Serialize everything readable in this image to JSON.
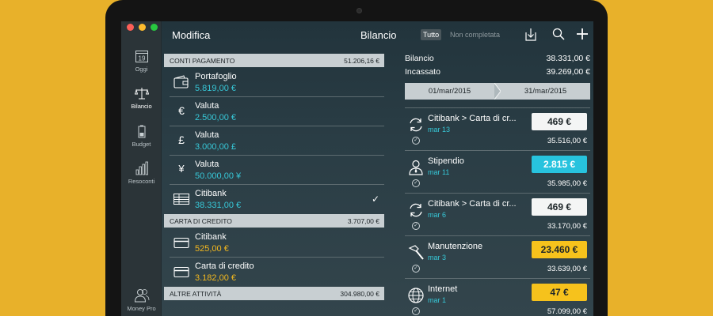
{
  "sidebar": {
    "items": [
      {
        "label": "Oggi",
        "icon": "calendar-icon",
        "day": "19"
      },
      {
        "label": "Bilancio",
        "icon": "balance-scale-icon"
      },
      {
        "label": "Budget",
        "icon": "battery-icon"
      },
      {
        "label": "Resoconti",
        "icon": "bar-chart-icon"
      },
      {
        "label": "Money Pro",
        "icon": "users-icon"
      }
    ]
  },
  "toolbar": {
    "edit_label": "Modifica",
    "title": "Bilancio",
    "filter_all": "Tutto",
    "filter_incomplete": "Non completata"
  },
  "accounts": {
    "sections": [
      {
        "header": "CONTI PAGAMENTO",
        "total": "51.206,16 €"
      },
      {
        "header": "CARTA DI CREDITO",
        "total": "3.707,00 €"
      },
      {
        "header": "ALTRE ATTIVITÀ",
        "total": "304.980,00 €"
      }
    ],
    "rows": [
      {
        "name": "Portafoglio",
        "amount": "5.819,00 €",
        "icon": "wallet-icon"
      },
      {
        "name": "Valuta",
        "amount": "2.500,00 €",
        "icon": "euro-icon",
        "symbol": "€"
      },
      {
        "name": "Valuta",
        "amount": "3.000,00 £",
        "icon": "pound-icon",
        "symbol": "£"
      },
      {
        "name": "Valuta",
        "amount": "50.000,00 ¥",
        "icon": "yen-icon",
        "symbol": "¥"
      },
      {
        "name": "Citibank",
        "amount": "38.331,00 €",
        "icon": "bank-ledger-icon"
      },
      {
        "name": "Citibank",
        "amount": "525,00 €",
        "icon": "credit-card-icon"
      },
      {
        "name": "Carta di credito",
        "amount": "3.182,00 €",
        "icon": "credit-card-icon"
      }
    ],
    "selected_check": "✓"
  },
  "summary": {
    "balance_label": "Bilancio",
    "balance_value": "38.331,00 €",
    "cashed_label": "Incassato",
    "cashed_value": "39.269,00 €",
    "date_from": "01/mar/2015",
    "date_to": "31/mar/2015"
  },
  "transactions": [
    {
      "title": "Citibank > Carta di cr...",
      "date": "mar 13",
      "amount": "469 €",
      "balance": "35.516,00 €",
      "icon": "transfer-icon",
      "style": "white"
    },
    {
      "title": "Stipendio",
      "date": "mar 11",
      "amount": "2.815 €",
      "balance": "35.985,00 €",
      "icon": "person-icon",
      "style": "teal"
    },
    {
      "title": "Citibank > Carta di cr...",
      "date": "mar 6",
      "amount": "469 €",
      "balance": "33.170,00 €",
      "icon": "transfer-icon",
      "style": "white"
    },
    {
      "title": "Manutenzione",
      "date": "mar 3",
      "amount": "23.460 €",
      "balance": "33.639,00 €",
      "icon": "hammer-icon",
      "style": "yellow"
    },
    {
      "title": "Internet",
      "date": "mar 1",
      "amount": "47 €",
      "balance": "57.099,00 €",
      "icon": "globe-icon",
      "style": "yellow"
    }
  ],
  "colors": {
    "background": "#e8b12a",
    "accent_teal": "#37c8d8",
    "accent_gold": "#f3b81e"
  }
}
